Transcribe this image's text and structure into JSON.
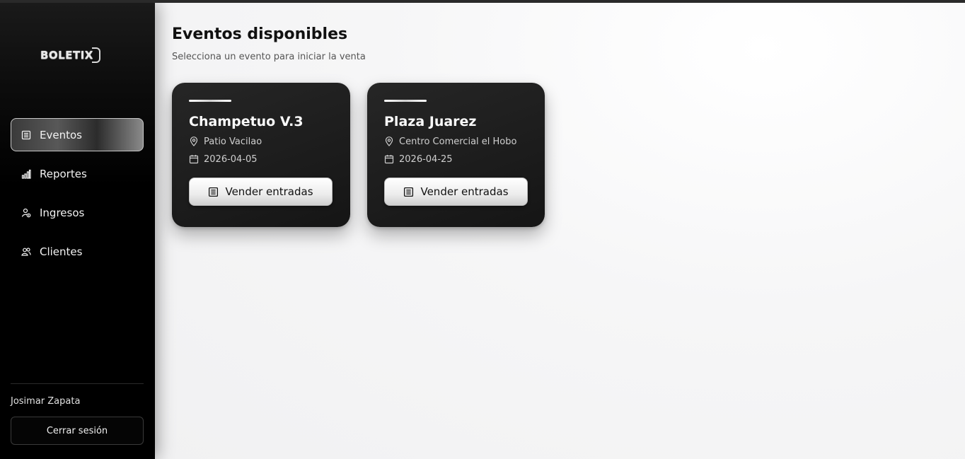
{
  "app": {
    "logo_text": "BOLETIX",
    "logo_mark": "3"
  },
  "sidebar": {
    "items": [
      {
        "label": "Eventos",
        "icon": "calendar-list-icon",
        "active": true
      },
      {
        "label": "Reportes",
        "icon": "bar-chart-icon",
        "active": false
      },
      {
        "label": "Ingresos",
        "icon": "user-money-icon",
        "active": false
      },
      {
        "label": "Clientes",
        "icon": "users-icon",
        "active": false
      }
    ],
    "user_name": "Josimar Zapata",
    "logout_label": "Cerrar sesión"
  },
  "main": {
    "title": "Eventos disponibles",
    "subtitle": "Selecciona un evento para iniciar la venta",
    "events": [
      {
        "name": "Champetuo V.3",
        "venue": "Patio Vacilao",
        "date": "2026-04-05",
        "button_label": "Vender entradas"
      },
      {
        "name": "Plaza Juarez",
        "venue": "Centro Comercial el Hobo",
        "date": "2026-04-25",
        "button_label": "Vender entradas"
      }
    ]
  },
  "colors": {
    "sidebar_bg": "#000000",
    "card_bg": "#1e1e1e",
    "main_bg": "#f4f4f5",
    "active_border": "#c9c9c9"
  }
}
